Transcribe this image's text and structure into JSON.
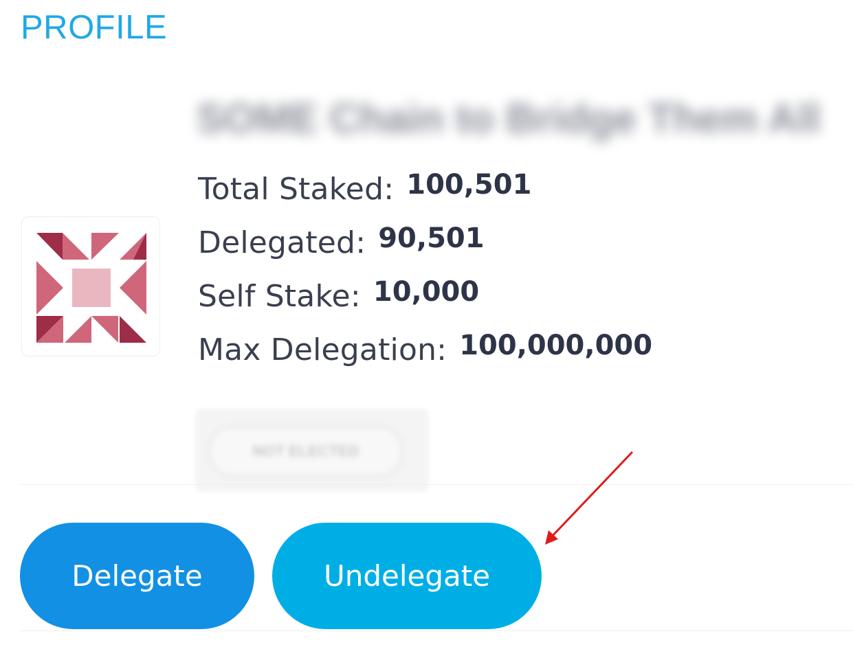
{
  "header": {
    "title": "PROFILE"
  },
  "validator": {
    "name": "SOME Chain to Bridge Them All",
    "avatar_icon": "identicon-pinwheel-icon",
    "avatar_colors": [
      "#9e2d47",
      "#d0667a",
      "#eab7c0"
    ]
  },
  "stats": [
    {
      "label": "Total Staked:",
      "value": "100,501"
    },
    {
      "label": "Delegated:",
      "value": "90,501"
    },
    {
      "label": "Self Stake:",
      "value": "10,000"
    },
    {
      "label": "Max Delegation:",
      "value": "100,000,000"
    }
  ],
  "status": {
    "label": "NOT ELECTED"
  },
  "actions": {
    "delegate_label": "Delegate",
    "undelegate_label": "Undelegate"
  },
  "annotation": {
    "icon": "red-arrow-icon",
    "color": "#e01b1b"
  },
  "colors": {
    "accent": "#1fa9e6",
    "delegate_button": "#1290e4",
    "undelegate_button": "#00aee6"
  }
}
